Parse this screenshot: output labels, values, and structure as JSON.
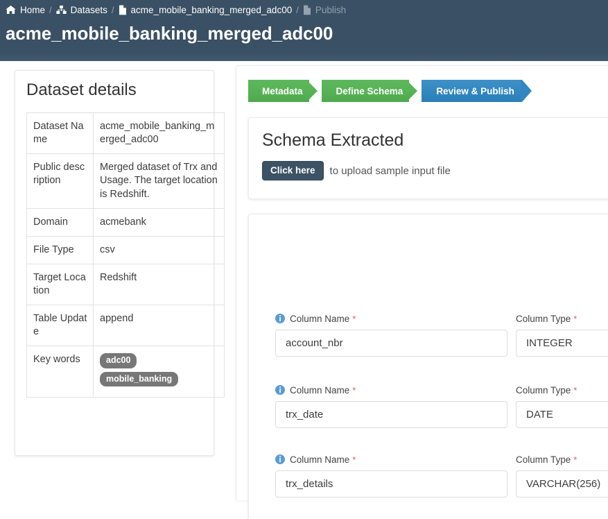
{
  "breadcrumb": {
    "items": [
      {
        "label": "Home",
        "icon": "home-icon",
        "muted": false
      },
      {
        "label": "Datasets",
        "icon": "sitemap-icon",
        "muted": false
      },
      {
        "label": "acme_mobile_banking_merged_adc00",
        "icon": "file-icon",
        "muted": false
      },
      {
        "label": "Publish",
        "icon": "file-icon",
        "muted": true
      }
    ],
    "separator": "/"
  },
  "header": {
    "title": "acme_mobile_banking_merged_adc00",
    "background_color": "#3a5064"
  },
  "details": {
    "title": "Dataset details",
    "rows": [
      {
        "key": "Dataset Name",
        "value": "acme_mobile_banking_merged_adc00"
      },
      {
        "key": "Public description",
        "value": "Merged dataset of Trx and Usage. The target location is Redshift."
      },
      {
        "key": "Domain",
        "value": "acmebank"
      },
      {
        "key": "File Type",
        "value": "csv"
      },
      {
        "key": "Target Location",
        "value": "Redshift"
      },
      {
        "key": "Table Update",
        "value": "append"
      }
    ],
    "keywords_label": "Key words",
    "keywords": [
      "adc00",
      "mobile_banking"
    ]
  },
  "wizard": {
    "steps": [
      {
        "label": "Metadata",
        "state": "done",
        "color": "#5cb85c"
      },
      {
        "label": "Define Schema",
        "state": "done",
        "color": "#5cb85c"
      },
      {
        "label": "Review & Publish",
        "state": "active",
        "color": "#3287c0"
      }
    ]
  },
  "schema_panel": {
    "title": "Schema Extracted",
    "upload_button": "Click here",
    "upload_text": "to upload sample input file"
  },
  "columns_form": {
    "name_label": "Column Name",
    "type_label": "Column Type",
    "required_marker": "*",
    "rows": [
      {
        "name": "account_nbr",
        "type": "INTEGER"
      },
      {
        "name": "trx_date",
        "type": "DATE"
      },
      {
        "name": "trx_details",
        "type": "VARCHAR(256)"
      }
    ]
  }
}
